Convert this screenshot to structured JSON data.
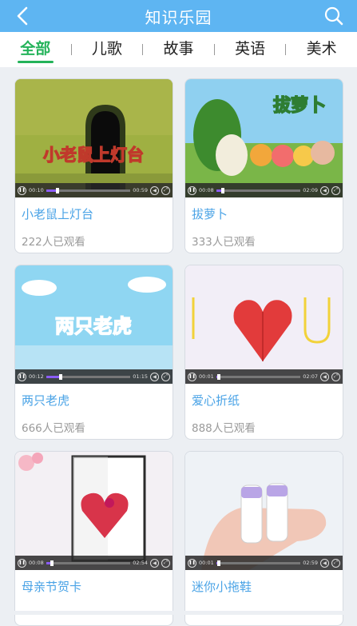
{
  "header": {
    "title": "知识乐园",
    "back_icon": "back-arrow-icon",
    "search_icon": "search-icon",
    "bg": "#5eb5f2"
  },
  "tabs": [
    {
      "label": "全部",
      "active": true
    },
    {
      "label": "儿歌",
      "active": false
    },
    {
      "label": "故事",
      "active": false
    },
    {
      "label": "英语",
      "active": false
    },
    {
      "label": "美术",
      "active": false
    }
  ],
  "accent": "#24b35a",
  "cards": [
    {
      "title": "小老鼠上灯台",
      "views": "222人已观看",
      "overlay": "小老鼠上灯台",
      "time_now": "00:10",
      "time_total": "00:59",
      "progress": 0.12
    },
    {
      "title": "拔萝卜",
      "views": "333人已观看",
      "overlay": "拔萝卜",
      "time_now": "00:08",
      "time_total": "02:09",
      "progress": 0.06
    },
    {
      "title": "两只老虎",
      "views": "666人已观看",
      "overlay": "两只老虎",
      "time_now": "00:12",
      "time_total": "01:15",
      "progress": 0.15
    },
    {
      "title": "爱心折纸",
      "views": "888人已观看",
      "overlay": "",
      "time_now": "00:01",
      "time_total": "02:07",
      "progress": 0.01
    },
    {
      "title": "母亲节贺卡",
      "views": "",
      "overlay": "",
      "time_now": "00:08",
      "time_total": "02:54",
      "progress": 0.05
    },
    {
      "title": "迷你小拖鞋",
      "views": "",
      "overlay": "",
      "time_now": "00:01",
      "time_total": "02:59",
      "progress": 0.01
    }
  ]
}
